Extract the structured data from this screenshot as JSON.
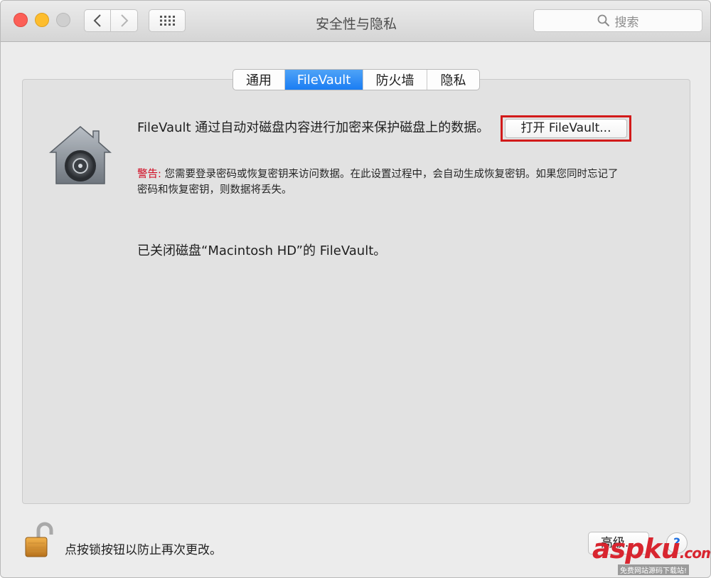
{
  "window": {
    "title": "安全性与隐私"
  },
  "search": {
    "placeholder": "搜索"
  },
  "tabs": [
    {
      "label": "通用"
    },
    {
      "label": "FileVault"
    },
    {
      "label": "防火墙"
    },
    {
      "label": "隐私"
    }
  ],
  "filevault": {
    "description": "FileVault 通过自动对磁盘内容进行加密来保护磁盘上的数据。",
    "turn_on_button": "打开 FileVault...",
    "warning_label": "警告:",
    "warning_text": " 您需要登录密码或恢复密钥来访问数据。在此设置过程中，会自动生成恢复密钥。如果您同时忘记了密码和恢复密钥，则数据将丢失。",
    "status": "已关闭磁盘“Macintosh HD”的 FileVault。"
  },
  "footer": {
    "lock_text": "点按锁按钮以防止再次更改。",
    "advanced_button": "高级...",
    "help_button": "?"
  },
  "watermark": {
    "text": "aspku",
    "suffix": ".com",
    "subtext": "免费网站源码下载站!"
  },
  "colors": {
    "accent": "#1a7df3",
    "warning": "#d0021b",
    "highlight": "#d21a1a"
  }
}
